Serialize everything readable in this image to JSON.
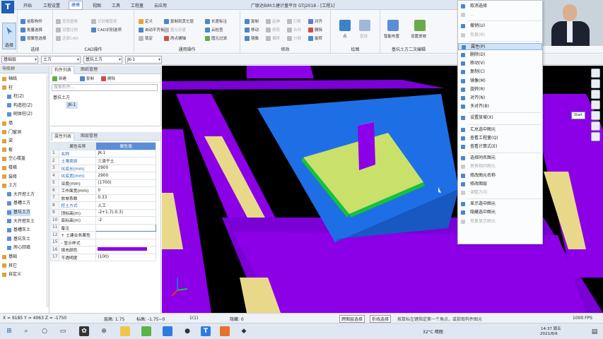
{
  "app": {
    "logo": "T",
    "title": "广联达BIM土建计量平台 GTJ2018 - [工程1]"
  },
  "menu_tabs": [
    "开始",
    "工程设置",
    "建模",
    "视图",
    "工具",
    "工程量",
    "云应用"
  ],
  "ribbon": {
    "select_label": "选择",
    "select_group": "选择",
    "group_select_items": [
      "拾取构件",
      "批量选择",
      "按属性选择"
    ],
    "cad_group": "CAD操作",
    "cad_items": [
      "查找替换",
      "设置比例",
      "还原CAD",
      "识别楼层表",
      "CAD识别选项"
    ],
    "common_group": "通用操作",
    "common_items": [
      "定义",
      "复制到其它层",
      "长度标注",
      "云检查",
      "自动平齐板",
      "图元存盘",
      "锁定",
      "两点辅轴",
      "图元过滤"
    ],
    "modify_group": "修改",
    "modify_items": [
      "复制",
      "延伸",
      "打断",
      "对齐",
      "移动",
      "修剪",
      "合并",
      "删除",
      "镜像",
      "偏移",
      "分割",
      "旋转"
    ],
    "draw_group": "绘图",
    "draw_items": [
      "点",
      "直线"
    ],
    "pit_group": "基坑土方二次编辑",
    "pit_items": [
      "智能布置",
      "设置放坡"
    ]
  },
  "propbar": {
    "floor": "基础层",
    "category": "土方",
    "type": "基坑土方",
    "element": "JK-1"
  },
  "nav": {
    "header": "导航树",
    "items": [
      {
        "label": "轴线",
        "level": 0
      },
      {
        "label": "柱",
        "level": 0
      },
      {
        "label": "柱(Z)",
        "level": 1
      },
      {
        "label": "构造柱(Z)",
        "level": 1
      },
      {
        "label": "砌体柱(Z)",
        "level": 1
      },
      {
        "label": "墙",
        "level": 0
      },
      {
        "label": "门窗洞",
        "level": 0
      },
      {
        "label": "梁",
        "level": 0
      },
      {
        "label": "板",
        "level": 0
      },
      {
        "label": "空心楼盖",
        "level": 0
      },
      {
        "label": "楼梯",
        "level": 0
      },
      {
        "label": "装修",
        "level": 0
      },
      {
        "label": "土方",
        "level": 0
      },
      {
        "label": "大开挖土方",
        "level": 1
      },
      {
        "label": "基槽土方",
        "level": 1
      },
      {
        "label": "基坑土方",
        "level": 1
      },
      {
        "label": "大开挖灰土",
        "level": 1
      },
      {
        "label": "基槽灰土",
        "level": 1
      },
      {
        "label": "基坑灰土",
        "level": 1
      },
      {
        "label": "房心回填",
        "level": 1
      },
      {
        "label": "基础",
        "level": 0
      },
      {
        "label": "其它",
        "level": 0
      },
      {
        "label": "自定义",
        "level": 0
      }
    ]
  },
  "component": {
    "tabs": [
      "构件列表",
      "图纸管理"
    ],
    "new_label": "新建",
    "copy_label": "复制",
    "delete_label": "删除",
    "search_placeholder": "搜索构件...",
    "tree_root": "基坑土方",
    "tree_child": "JK-1"
  },
  "properties": {
    "tabs": [
      "属性列表",
      "图层管理"
    ],
    "headers": [
      "属性名称",
      "属性值"
    ],
    "rows": [
      {
        "n": "1",
        "k": "名称",
        "v": "JK-1",
        "blue": true
      },
      {
        "n": "2",
        "k": "土壤类别",
        "v": "三类干土",
        "blue": true
      },
      {
        "n": "3",
        "k": "坑底长(mm)",
        "v": "2900",
        "blue": true
      },
      {
        "n": "4",
        "k": "坑底宽(mm)",
        "v": "2900",
        "blue": true
      },
      {
        "n": "5",
        "k": "深度(mm)",
        "v": "(1700)",
        "blue": false
      },
      {
        "n": "6",
        "k": "工作面宽(mm)",
        "v": "0",
        "blue": false
      },
      {
        "n": "7",
        "k": "放坡系数",
        "v": "0.33",
        "blue": false
      },
      {
        "n": "8",
        "k": "挖土方式",
        "v": "人工",
        "blue": true
      },
      {
        "n": "9",
        "k": "顶标高(m)",
        "v": "-2+1.7(-0.3)",
        "blue": false
      },
      {
        "n": "10",
        "k": "底标高(m)",
        "v": "-2",
        "blue": false
      },
      {
        "n": "11",
        "k": "备注",
        "v": "",
        "blue": false
      },
      {
        "n": "12",
        "k": "+ 土建业务属性",
        "v": "",
        "blue": false
      },
      {
        "n": "15",
        "k": "- 显示样式",
        "v": "",
        "blue": false
      },
      {
        "n": "16",
        "k": "填充颜色",
        "v": "",
        "blue": false
      },
      {
        "n": "17",
        "k": "不透明度",
        "v": "(100)",
        "blue": false
      }
    ]
  },
  "context_menu": [
    {
      "label": "取消选择",
      "dim": false
    },
    {
      "label": "…",
      "dim": true
    },
    {
      "label": "撤销(U)",
      "dim": false
    },
    {
      "label": "恢复(R)",
      "dim": true
    },
    {
      "label": "属性(P)",
      "dim": false,
      "highlight": true
    },
    {
      "label": "删除(D)",
      "dim": false
    },
    {
      "label": "移动(V)",
      "dim": false
    },
    {
      "label": "复制(C)",
      "dim": false
    },
    {
      "label": "镜像(M)",
      "dim": false
    },
    {
      "label": "旋转(R)",
      "dim": false
    },
    {
      "label": "对齐(N)",
      "dim": false
    },
    {
      "label": "多对齐(B)",
      "dim": false
    },
    {
      "label": "设置放坡(X)",
      "dim": false
    },
    {
      "label": "汇总选中图元",
      "dim": false
    },
    {
      "label": "查看工程量(Q)",
      "dim": false
    },
    {
      "label": "查看计算式(E)",
      "dim": false
    },
    {
      "label": "选择同名图元",
      "dim": false
    },
    {
      "label": "替换相同图元",
      "dim": true
    },
    {
      "label": "修改图元名称",
      "dim": false
    },
    {
      "label": "修改图层",
      "dim": false
    },
    {
      "label": "调整方向",
      "dim": true
    },
    {
      "label": "显示选中图元",
      "dim": false
    },
    {
      "label": "隐藏选中图元",
      "dim": false
    },
    {
      "label": "恢复显示图元",
      "dim": true
    }
  ],
  "viewport": {
    "start_label": "Start"
  },
  "statusbar": {
    "coords": "X = 9185 Y = 4063 Z = -1750",
    "floor_height": "层高: 1.75",
    "elevation": "标高: -1.75~0",
    "count": "1(1)",
    "hidden": "隐藏: 0",
    "cross_select": "跨图层选择",
    "polyline_select": "折线选择",
    "hint": "按鼠标左键指定第一个角点，或拾取构件图元",
    "fps": "1000 FPS"
  },
  "taskbar": {
    "weather": "32°C 晴朗",
    "time": "14:37 周五",
    "date": "2021/8/6"
  },
  "colors": {
    "accent": "#1f5fb4",
    "beam": "#8b00e6",
    "pit_blue": "#1e6fe6",
    "pit_bottom": "#c9e06a",
    "ground_tan": "#e8d98a",
    "green_edge": "#15c23a"
  }
}
